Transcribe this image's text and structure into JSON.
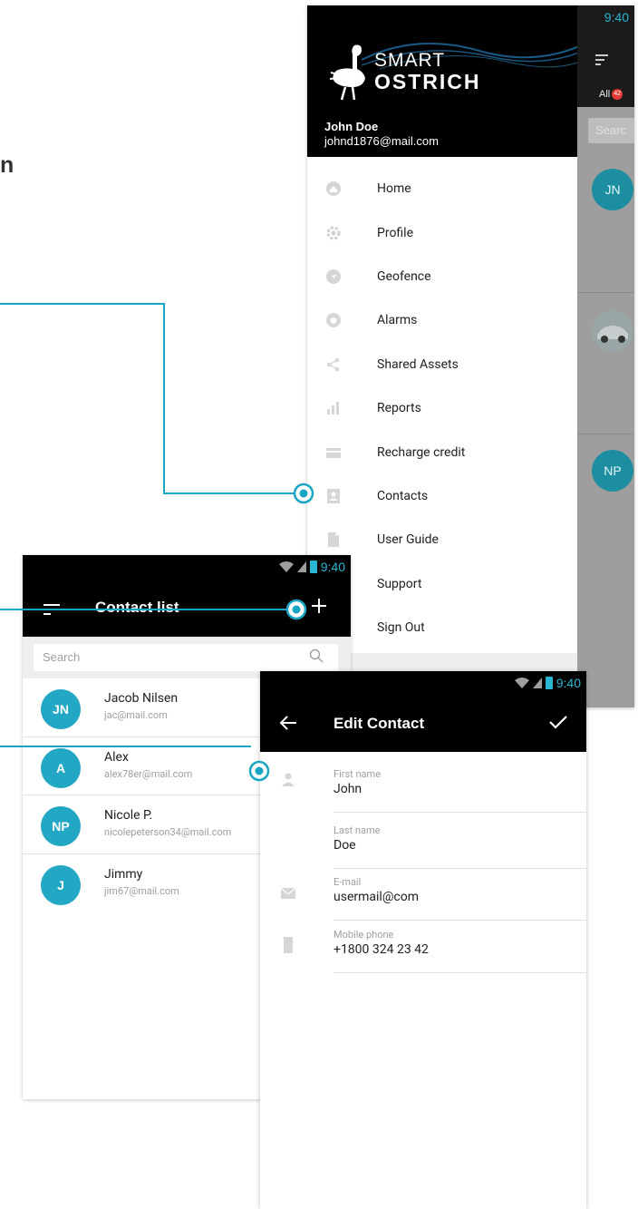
{
  "page": {
    "partial_heading": "n"
  },
  "status_bar": {
    "time": "9:40"
  },
  "drawer": {
    "logo": {
      "line1": "SMART",
      "line2": "OSTRICH"
    },
    "user": {
      "name": "John Doe",
      "email": "johnd1876@mail.com"
    },
    "menu": [
      {
        "label": "Home",
        "icon": "home-icon"
      },
      {
        "label": "Profile",
        "icon": "gear-icon"
      },
      {
        "label": "Geofence",
        "icon": "navigation-icon"
      },
      {
        "label": "Alarms",
        "icon": "alarm-icon"
      },
      {
        "label": "Shared Assets",
        "icon": "share-icon"
      },
      {
        "label": "Reports",
        "icon": "bar-chart-icon"
      },
      {
        "label": "Recharge credit",
        "icon": "credit-card-icon"
      },
      {
        "label": "Contacts",
        "icon": "contacts-icon"
      },
      {
        "label": "User Guide",
        "icon": "document-icon"
      },
      {
        "label": "Support",
        "icon": "support-icon"
      },
      {
        "label": "Sign Out",
        "icon": "sign-out-icon"
      }
    ],
    "behind": {
      "tab_label": "All",
      "badge": "42",
      "search_placeholder": "Searc",
      "avatars": [
        "JN",
        "NP"
      ]
    }
  },
  "contact_list": {
    "title": "Contact list",
    "search_placeholder": "Search",
    "contacts": [
      {
        "initials": "JN",
        "name": "Jacob Nilsen",
        "email": "jac@mail.com"
      },
      {
        "initials": "A",
        "name": "Alex",
        "email": "alex78er@mail.com"
      },
      {
        "initials": "NP",
        "name": "Nicole P.",
        "email": "nicolepeterson34@mail.com"
      },
      {
        "initials": "J",
        "name": "Jimmy",
        "email": "jim67@mail.com"
      }
    ]
  },
  "edit_contact": {
    "title": "Edit Contact",
    "fields": [
      {
        "label": "First name",
        "value": "John"
      },
      {
        "label": "Last name",
        "value": "Doe"
      },
      {
        "label": "E-mail",
        "value": "usermail@com"
      },
      {
        "label": "Mobile phone",
        "value": "+1800 324 23 42"
      }
    ]
  },
  "colors": {
    "accent": "#22a7c4",
    "callout": "#1aa6c2",
    "appbar": "#000000",
    "status_blue": "#29b6d0"
  }
}
